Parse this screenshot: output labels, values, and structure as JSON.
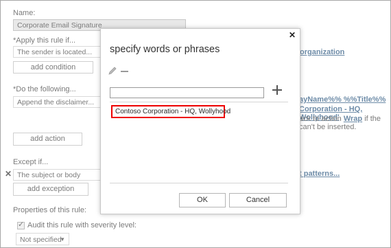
{
  "rule": {
    "name_label": "Name:",
    "name_value": "Corporate Email Signature",
    "apply_label": "*Apply this rule if...",
    "apply_value": "The sender is located...",
    "apply_link": "organization",
    "add_condition": "add condition",
    "do_label": "*Do the following...",
    "do_value": "Append the disclaimer...",
    "do_side_line1": "ayName%% %%Title%%",
    "do_side_line2": "Corporation - HQ, Wollyhood'",
    "do_side_line3_pre": "ack to action ",
    "do_side_line3_link": "Wrap",
    "do_side_line3_post": " if the",
    "do_side_line4": "can't be inserted.",
    "add_action": "add action",
    "except_label": "Except if...",
    "except_value": "The subject or body matches...",
    "except_link": "t patterns...",
    "add_exception": "add exception",
    "properties_label": "Properties of this rule:",
    "audit_label": "Audit this rule with severity level:",
    "severity_value": "Not specified"
  },
  "dialog": {
    "title": "specify words or phrases",
    "input_value": "",
    "item": "Contoso Corporation - HQ, Wollyhood",
    "ok": "OK",
    "cancel": "Cancel"
  }
}
